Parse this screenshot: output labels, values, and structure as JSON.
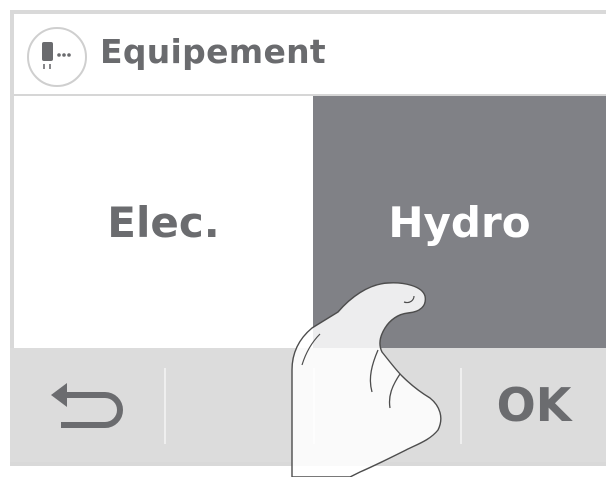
{
  "header": {
    "title": "Equipement",
    "icon": "equipment-icon"
  },
  "options": {
    "elec_label": "Elec.",
    "hydro_label": "Hydro",
    "selected": "Hydro"
  },
  "bottom_bar": {
    "back_icon": "back-arrow-icon",
    "ok_label": "OK"
  },
  "colors": {
    "selected_bg": "#808186",
    "text_gray": "#6b6c6f",
    "bottom_bar_bg": "#dcdcdc"
  }
}
